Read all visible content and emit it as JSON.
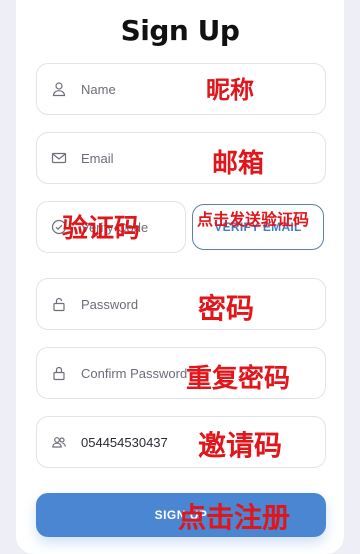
{
  "page": {
    "title": "Sign Up"
  },
  "fields": {
    "name": {
      "placeholder": "Name",
      "icon": "user-icon"
    },
    "email": {
      "placeholder": "Email",
      "icon": "mail-icon"
    },
    "code": {
      "placeholder": "Verify Code",
      "icon": "check-circle-icon"
    },
    "password": {
      "placeholder": "Password",
      "icon": "lock-open-icon"
    },
    "confirm_password": {
      "placeholder": "Confirm Password",
      "icon": "lock-icon"
    },
    "invite": {
      "value": "054454530437",
      "icon": "users-icon"
    }
  },
  "buttons": {
    "verify_email": "VERIFY EMAIL",
    "sign_up": "SIGN UP"
  },
  "annotations": {
    "nickname": "昵称",
    "email": "邮箱",
    "verify_code": "验证码",
    "send_code": "点击发送验证码",
    "password": "密码",
    "repeat_password": "重复密码",
    "invite_code": "邀请码",
    "register": "点击注册"
  },
  "colors": {
    "accent": "#4a86d2",
    "annotation": "#e0161b",
    "background": "#eeeef6"
  }
}
